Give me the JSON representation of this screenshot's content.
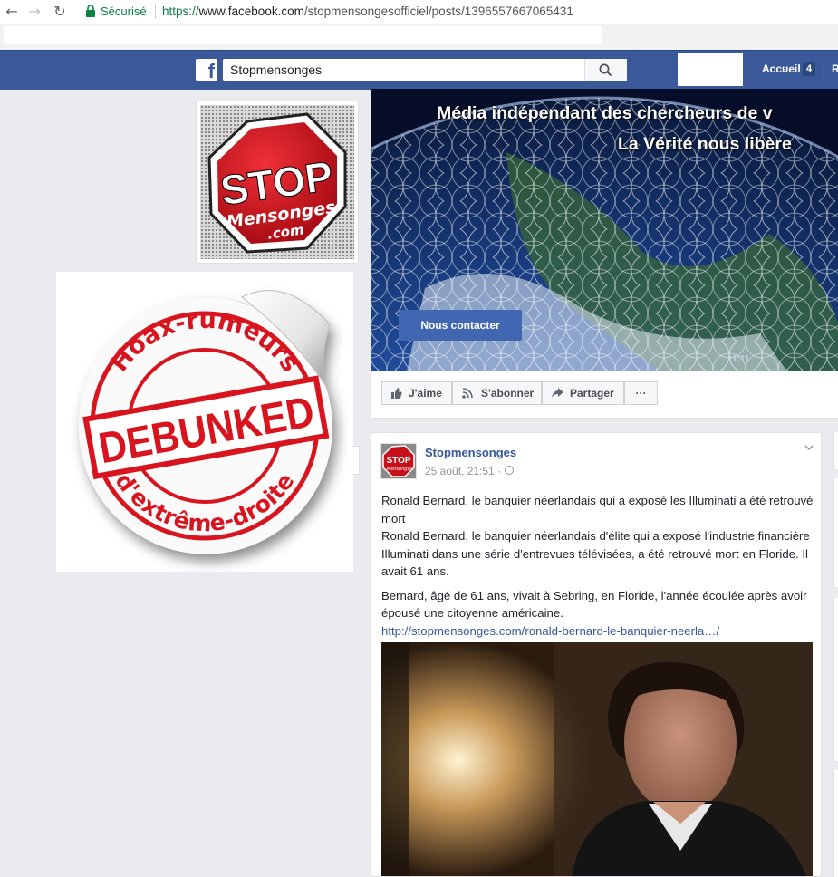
{
  "browser": {
    "secure_label": "Sécurisé",
    "url_protocol": "https://",
    "url_host": "www.facebook.com",
    "url_path": "/stopmensongesofficiel/posts/1396557667065431"
  },
  "fb_header": {
    "search_value": "Stopmensonges",
    "home_label": "Accueil",
    "home_count": "4",
    "next_label_partial": "R"
  },
  "profile": {
    "stop_text": "STOP",
    "logo_sub1": "Mensonges",
    "logo_sub2": ".com"
  },
  "sticker": {
    "top_text": "Hoax-rumeurs",
    "center_text": "DEBUNKED",
    "bottom_text": "d'extrême-droite"
  },
  "cover": {
    "line1": "Média indépendant des chercheurs de v",
    "line2": "La Vérité nous libère",
    "contact_button": "Nous contacter",
    "video_time": "11:11"
  },
  "actions": {
    "like": "J'aime",
    "follow": "S'abonner",
    "share": "Partager",
    "more": "···"
  },
  "post": {
    "author": "Stopmensonges",
    "date": "25 août, 21:51 ·",
    "paragraph1_line1": "Ronald Bernard, le banquier néerlandais qui a exposé les Illuminati a été retrouvé mort",
    "paragraph1_line2": "Ronald Bernard, le banquier néerlandais d'élite qui a exposé l'industrie financière Illuminati dans une série d'entrevues télévisées, a été retrouvé mort en Floride. Il avait 61 ans.",
    "paragraph2": "Bernard, âgé de 61 ans, vivait à Sebring, en Floride, l'année écoulée après avoir épousé une citoyenne américaine.",
    "link": "http://stopmensonges.com/ronald-bernard-le-banquier-neerla…/"
  },
  "colors": {
    "fb_blue": "#3b5998",
    "button_blue": "#4267b2",
    "link_blue": "#365899",
    "stop_red": "#c8101b",
    "stamp_red": "#d8141e"
  }
}
